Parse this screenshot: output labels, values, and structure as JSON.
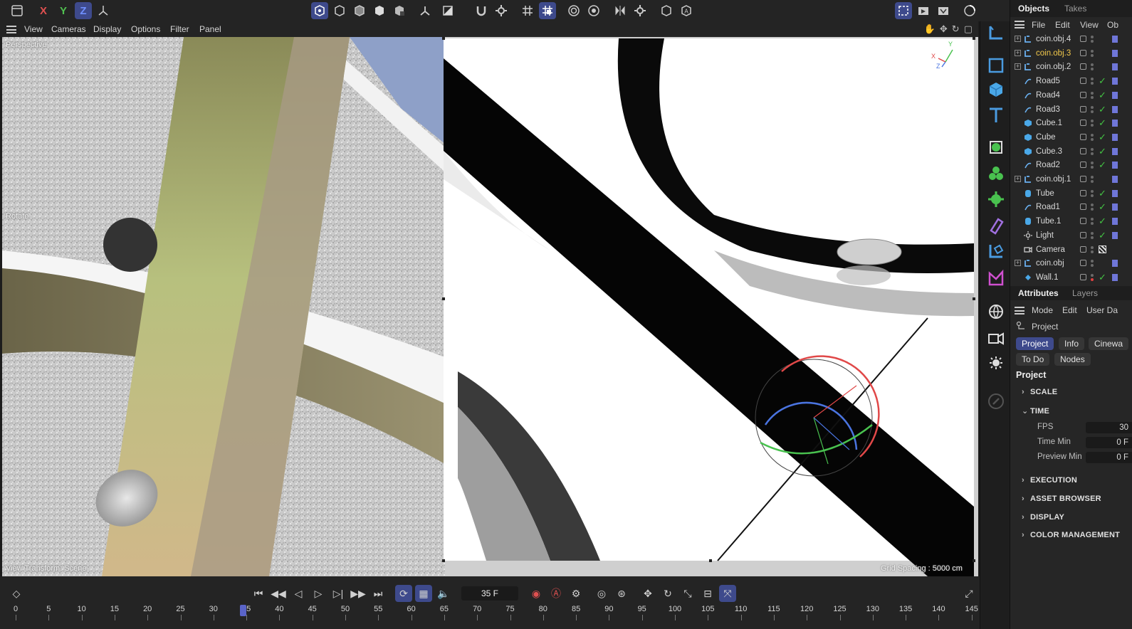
{
  "toolbar": {
    "axis_x": "X",
    "axis_y": "Y",
    "axis_z": "Z"
  },
  "viewport_menu": {
    "items": [
      "View",
      "Cameras",
      "Display",
      "Options",
      "Filter",
      "Panel"
    ]
  },
  "viewport": {
    "camera_label": "Perspective",
    "tool_label": "Rotate",
    "view_transform": "View Transform: Scene",
    "grid_spacing": "Grid Spacing : 5000 cm",
    "axis_x": "X",
    "axis_y": "Y",
    "axis_z": "Z"
  },
  "objects_panel": {
    "tabs": [
      "Objects",
      "Takes"
    ],
    "menu": [
      "File",
      "Edit",
      "View",
      "Ob"
    ],
    "items": [
      {
        "name": "coin.obj.4",
        "icon": "null-object-icon",
        "highlighted": false,
        "check": false,
        "expander": true
      },
      {
        "name": "coin.obj.3",
        "icon": "null-object-icon",
        "highlighted": true,
        "check": false,
        "expander": true
      },
      {
        "name": "coin.obj.2",
        "icon": "null-object-icon",
        "highlighted": false,
        "check": false,
        "expander": true
      },
      {
        "name": "Road5",
        "icon": "spline-icon",
        "highlighted": false,
        "check": true,
        "expander": false
      },
      {
        "name": "Road4",
        "icon": "spline-icon",
        "highlighted": false,
        "check": true,
        "expander": false
      },
      {
        "name": "Road3",
        "icon": "spline-icon",
        "highlighted": false,
        "check": true,
        "expander": false
      },
      {
        "name": "Cube.1",
        "icon": "cube-icon",
        "highlighted": false,
        "check": true,
        "expander": false
      },
      {
        "name": "Cube",
        "icon": "cube-icon",
        "highlighted": false,
        "check": true,
        "expander": false
      },
      {
        "name": "Cube.3",
        "icon": "cube-icon",
        "highlighted": false,
        "check": true,
        "expander": false
      },
      {
        "name": "Road2",
        "icon": "spline-icon",
        "highlighted": false,
        "check": true,
        "expander": false
      },
      {
        "name": "coin.obj.1",
        "icon": "null-object-icon",
        "highlighted": false,
        "check": false,
        "expander": true
      },
      {
        "name": "Tube",
        "icon": "tube-icon",
        "highlighted": false,
        "check": true,
        "expander": false
      },
      {
        "name": "Road1",
        "icon": "spline-icon",
        "highlighted": false,
        "check": true,
        "expander": false
      },
      {
        "name": "Tube.1",
        "icon": "tube-icon",
        "highlighted": false,
        "check": true,
        "expander": false
      },
      {
        "name": "Light",
        "icon": "light-icon",
        "highlighted": false,
        "check": true,
        "expander": false
      },
      {
        "name": "Camera",
        "icon": "camera-icon",
        "highlighted": false,
        "check": false,
        "expander": false
      },
      {
        "name": "coin.obj",
        "icon": "null-object-icon",
        "highlighted": false,
        "check": false,
        "expander": true
      },
      {
        "name": "Wall.1",
        "icon": "wall-icon",
        "highlighted": false,
        "check": true,
        "expander": false
      }
    ]
  },
  "attributes_panel": {
    "tabs": [
      "Attributes",
      "Layers"
    ],
    "menu": [
      "Mode",
      "Edit",
      "User Da"
    ],
    "breadcrumb": "Project",
    "buttons_row1": [
      "Project",
      "Info",
      "Cinewa"
    ],
    "buttons_row2": [
      "To Do",
      "Nodes"
    ],
    "heading": "Project",
    "sections": {
      "scale": "SCALE",
      "time": "TIME",
      "execution": "EXECUTION",
      "asset_browser": "ASSET BROWSER",
      "display": "DISPLAY",
      "color_management": "COLOR MANAGEMENT"
    },
    "fields": [
      {
        "label": "FPS",
        "value": "30"
      },
      {
        "label": "Time Min",
        "value": "0 F"
      },
      {
        "label": "Preview Min",
        "value": "0 F"
      }
    ]
  },
  "timeline": {
    "current_frame": "35 F",
    "ticks": [
      "0",
      "5",
      "10",
      "15",
      "20",
      "25",
      "30",
      "35",
      "40",
      "45",
      "50",
      "55",
      "60",
      "65",
      "70",
      "75",
      "80",
      "85",
      "90",
      "95",
      "100",
      "105",
      "110",
      "115",
      "120",
      "125",
      "130",
      "135",
      "140",
      "145"
    ],
    "playhead_frame": 35
  },
  "colors": {
    "accent": "#3e4a8c",
    "highlight_text": "#f2c94c",
    "check_green": "#43c243",
    "axis_x": "#e04848",
    "axis_y": "#49c24f",
    "axis_z": "#4a74e0"
  }
}
